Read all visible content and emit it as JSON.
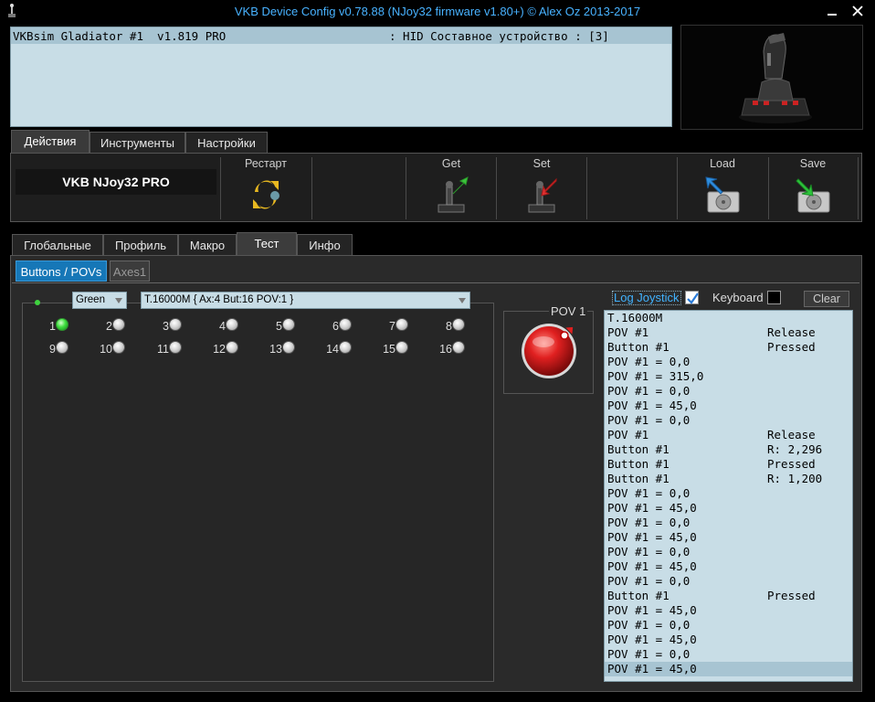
{
  "window": {
    "title": "VKB Device Config v0.78.88 (NJoy32 firmware v1.80+) © Alex Oz 2013-2017",
    "minimize_icon": "minimize-icon",
    "close_icon": "close-icon"
  },
  "device_list": {
    "name": "VKBsim Gladiator #1  v1.819 PRO",
    "hid": ": HID Составное устройство : [3]"
  },
  "main_tabs": [
    "Действия",
    "Инструменты",
    "Настройки"
  ],
  "toolbar": {
    "device_label": "VKB NJoy32 PRO",
    "restart": "Рестарт",
    "get": "Get",
    "set": "Set",
    "load": "Load",
    "save": "Save"
  },
  "section_tabs": [
    "Глобальные",
    "Профиль",
    "Макро",
    "Тест",
    "Инфо"
  ],
  "sub_tabs": {
    "buttons_povs": "Buttons / POVs",
    "axes": "Axes1"
  },
  "test": {
    "color_select": "Green",
    "device_select": "T.16000M { Ax:4 But:16 POV:1 }",
    "buttons": [
      {
        "n": "1",
        "on": true
      },
      {
        "n": "2",
        "on": false
      },
      {
        "n": "3",
        "on": false
      },
      {
        "n": "4",
        "on": false
      },
      {
        "n": "5",
        "on": false
      },
      {
        "n": "6",
        "on": false
      },
      {
        "n": "7",
        "on": false
      },
      {
        "n": "8",
        "on": false
      },
      {
        "n": "9",
        "on": false
      },
      {
        "n": "10",
        "on": false
      },
      {
        "n": "11",
        "on": false
      },
      {
        "n": "12",
        "on": false
      },
      {
        "n": "13",
        "on": false
      },
      {
        "n": "14",
        "on": false
      },
      {
        "n": "15",
        "on": false
      },
      {
        "n": "16",
        "on": false
      }
    ],
    "pov_title": "POV 1",
    "pov_angle": 45
  },
  "log": {
    "log_joystick_label": "Log Joystick",
    "log_joystick_checked": true,
    "keyboard_label": "Keyboard",
    "keyboard_checked": false,
    "clear_label": "Clear",
    "lines": [
      {
        "a": "T.16000M",
        "b": ""
      },
      {
        "a": "POV #1",
        "b": "Release"
      },
      {
        "a": "Button #1",
        "b": "Pressed"
      },
      {
        "a": "POV #1 = 0,0",
        "b": ""
      },
      {
        "a": "POV #1 = 315,0",
        "b": ""
      },
      {
        "a": "POV #1 = 0,0",
        "b": ""
      },
      {
        "a": "POV #1 = 45,0",
        "b": ""
      },
      {
        "a": "POV #1 = 0,0",
        "b": ""
      },
      {
        "a": "POV #1",
        "b": "Release"
      },
      {
        "a": "Button #1",
        "b": "R: 2,296"
      },
      {
        "a": "Button #1",
        "b": "Pressed"
      },
      {
        "a": "Button #1",
        "b": "R: 1,200"
      },
      {
        "a": "POV #1 = 0,0",
        "b": ""
      },
      {
        "a": "POV #1 = 45,0",
        "b": ""
      },
      {
        "a": "POV #1 = 0,0",
        "b": ""
      },
      {
        "a": "POV #1 = 45,0",
        "b": ""
      },
      {
        "a": "POV #1 = 0,0",
        "b": ""
      },
      {
        "a": "POV #1 = 45,0",
        "b": ""
      },
      {
        "a": "POV #1 = 0,0",
        "b": ""
      },
      {
        "a": "Button #1",
        "b": "Pressed"
      },
      {
        "a": "POV #1 = 45,0",
        "b": ""
      },
      {
        "a": "POV #1 = 0,0",
        "b": ""
      },
      {
        "a": "POV #1 = 45,0",
        "b": ""
      },
      {
        "a": "POV #1 = 0,0",
        "b": ""
      },
      {
        "a": "POV #1 = 45,0",
        "b": "",
        "selected": true
      }
    ]
  }
}
